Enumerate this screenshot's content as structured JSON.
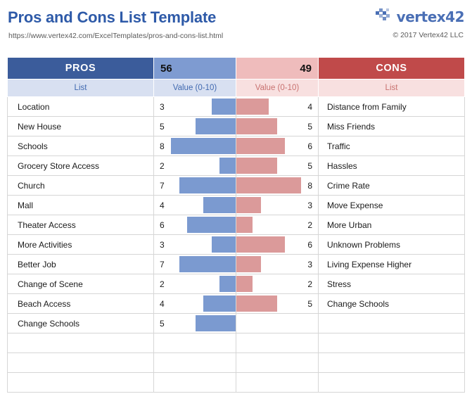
{
  "header": {
    "title": "Pros and Cons List Template",
    "url": "https://www.vertex42.com/ExcelTemplates/pros-and-cons-list.html",
    "logo_text": "vertex42",
    "copyright": "© 2017 Vertex42 LLC"
  },
  "table": {
    "pros_header": "PROS",
    "cons_header": "CONS",
    "pros_total": "56",
    "cons_total": "49",
    "sub_list": "List",
    "sub_value": "Value (0-10)",
    "max_value": 10,
    "empty_rows": 3
  },
  "colors": {
    "pros_header_bg": "#3B5C9B",
    "pros_value_bg": "#7E9BD1",
    "cons_value_bg": "#EFBCBC",
    "cons_header_bg": "#C04A4A",
    "pros_sub_bg": "#D8E0F1",
    "cons_sub_bg": "#F8E0E0",
    "pros_sub_text": "#4069B0",
    "cons_sub_text": "#C8716F",
    "blue_bar": "#7B9AD0",
    "red_bar": "#DB9A9A",
    "title_text": "#2E5AA8",
    "grid_line": "#D6D6D6"
  },
  "chart_data": {
    "type": "bar",
    "title": "Pros and Cons List Template",
    "xlabel": "Value (0-10)",
    "ylabel": "",
    "xlim": [
      0,
      10
    ],
    "grid": false,
    "legend": [
      "PROS",
      "CONS"
    ],
    "pros_total": 56,
    "cons_total": 49,
    "pros": [
      {
        "label": "Location",
        "value": 3
      },
      {
        "label": "New House",
        "value": 5
      },
      {
        "label": "Schools",
        "value": 8
      },
      {
        "label": "Grocery Store Access",
        "value": 2
      },
      {
        "label": "Church",
        "value": 7
      },
      {
        "label": "Mall",
        "value": 4
      },
      {
        "label": "Theater Access",
        "value": 6
      },
      {
        "label": "More Activities",
        "value": 3
      },
      {
        "label": "Better Job",
        "value": 7
      },
      {
        "label": "Change of Scene",
        "value": 2
      },
      {
        "label": "Beach Access",
        "value": 4
      },
      {
        "label": "Change Schools",
        "value": 5
      }
    ],
    "cons": [
      {
        "label": "Distance from Family",
        "value": 4
      },
      {
        "label": "Miss Friends",
        "value": 5
      },
      {
        "label": "Traffic",
        "value": 6
      },
      {
        "label": "Hassles",
        "value": 5
      },
      {
        "label": "Crime Rate",
        "value": 8
      },
      {
        "label": "Move Expense",
        "value": 3
      },
      {
        "label": "More Urban",
        "value": 2
      },
      {
        "label": "Unknown Problems",
        "value": 6
      },
      {
        "label": "Living Expense Higher",
        "value": 3
      },
      {
        "label": "Stress",
        "value": 2
      },
      {
        "label": "Change Schools",
        "value": 5
      }
    ]
  }
}
